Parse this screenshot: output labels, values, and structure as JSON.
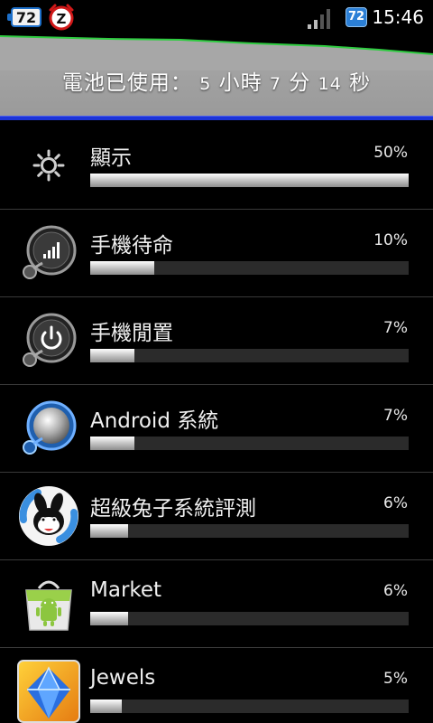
{
  "status_bar": {
    "battery_left_level": "72",
    "battery_right_level": "72",
    "time": "15:46",
    "icons": [
      "battery-icon",
      "alarm-clock-icon",
      "signal-icon",
      "battery-icon"
    ]
  },
  "header": {
    "label": "電池已使用：",
    "hours": "5",
    "hours_unit": "小時",
    "minutes": "7",
    "minutes_unit": "分",
    "seconds": "14",
    "seconds_unit": "秒",
    "graph_line_color": "#2ecc40",
    "accent_line_color": "#1c34d8"
  },
  "items": [
    {
      "name": "顯示",
      "percent_label": "50%",
      "percent": 50,
      "icon": "brightness-icon"
    },
    {
      "name": "手機待命",
      "percent_label": "10%",
      "percent": 10,
      "icon": "signal-standby-icon"
    },
    {
      "name": "手機閒置",
      "percent_label": "7%",
      "percent": 7,
      "icon": "power-idle-icon"
    },
    {
      "name": "Android 系統",
      "percent_label": "7%",
      "percent": 7,
      "icon": "android-system-icon"
    },
    {
      "name": "超級兔子系統評測",
      "percent_label": "6%",
      "percent": 6,
      "icon": "rabbit-app-icon"
    },
    {
      "name": "Market",
      "percent_label": "6%",
      "percent": 6,
      "icon": "market-bag-icon"
    },
    {
      "name": "Jewels",
      "percent_label": "5%",
      "percent": 5,
      "icon": "jewels-gem-icon"
    }
  ]
}
